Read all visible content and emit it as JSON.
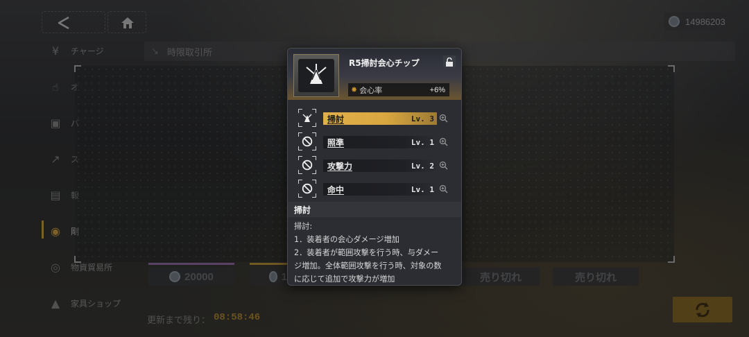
{
  "header": {
    "currency_value": "14986203"
  },
  "sidebar": {
    "items": [
      {
        "label": "チャージ",
        "icon": "yen-icon"
      },
      {
        "label": "オ",
        "icon": "thumbs-up-icon"
      },
      {
        "label": "パ",
        "icon": "gift-icon"
      },
      {
        "label": "ス",
        "icon": "trend-icon"
      },
      {
        "label": "報",
        "icon": "news-icon"
      },
      {
        "label": "剛",
        "icon": "token-icon"
      },
      {
        "label": "物資貿易所",
        "icon": "trade-icon"
      },
      {
        "label": "家具ショップ",
        "icon": "sofa-icon"
      }
    ]
  },
  "tab": {
    "label": "時限取引所"
  },
  "shop": {
    "price_buttons": [
      {
        "label": "20000",
        "has_coin": true
      },
      {
        "label": "1",
        "has_coin": true
      },
      {
        "label": "売り切れ",
        "has_coin": false
      },
      {
        "label": "売り切れ",
        "has_coin": false
      }
    ],
    "refresh_label": "更新まで残り：",
    "refresh_time": "08:58:46"
  },
  "modal": {
    "title": "R5掃討会心チップ",
    "stat": {
      "label": "会心率",
      "value": "+6%"
    },
    "skills": [
      {
        "name": "掃討",
        "level": "Lv. 3",
        "active": true
      },
      {
        "name": "照準",
        "level": "Lv. 1",
        "active": false
      },
      {
        "name": "攻撃力",
        "level": "Lv. 2",
        "active": false
      },
      {
        "name": "命中",
        "level": "Lv. 1",
        "active": false
      }
    ],
    "desc_title": "掃討",
    "desc_lines": [
      "掃討:",
      "1．装着者の会心ダメージ増加",
      "2．装着者が範囲攻撃を行う時、与ダメー",
      "ジ増加。全体範囲攻撃を行う時、対象の数",
      "に応じて追加で攻撃力が増加"
    ]
  },
  "colors": {
    "accent_gold": "#d9a740",
    "timer": "#b8912e",
    "modal_bg": "#2b2d33"
  }
}
